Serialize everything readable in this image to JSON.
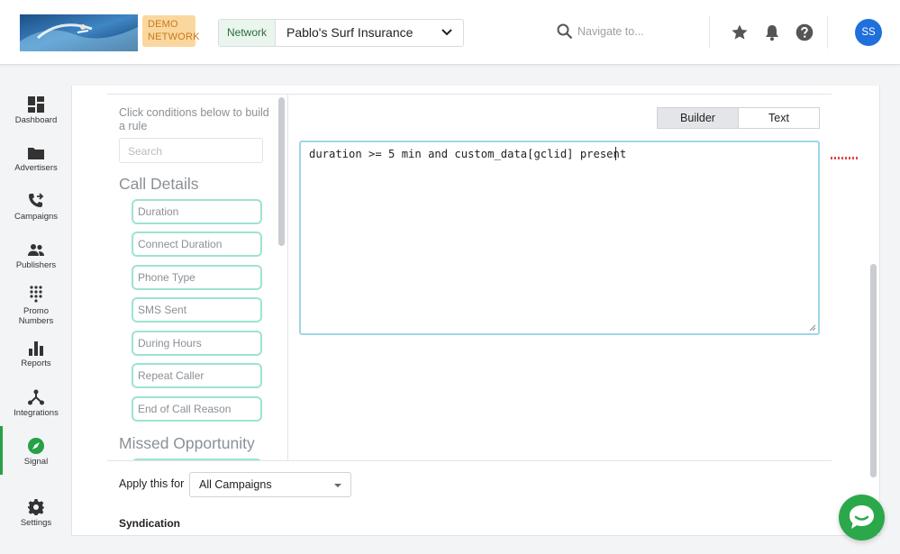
{
  "header": {
    "demo_badge": "DEMO NETWORK",
    "network_label": "Network",
    "network_value": "Pablo's Surf Insurance",
    "search_placeholder": "Navigate to...",
    "avatar_initials": "SS"
  },
  "sidebar": {
    "items": [
      {
        "label": "Dashboard",
        "icon": "dashboard-icon"
      },
      {
        "label": "Advertisers",
        "icon": "folder-icon"
      },
      {
        "label": "Campaigns",
        "icon": "phone-forward-icon"
      },
      {
        "label": "Publishers",
        "icon": "people-icon"
      },
      {
        "label": "Promo",
        "label2": "Numbers",
        "icon": "dialpad-icon"
      },
      {
        "label": "Reports",
        "icon": "bar-chart-icon"
      },
      {
        "label": "Integrations",
        "icon": "integrations-icon"
      },
      {
        "label": "Signal",
        "icon": "compass-icon",
        "active": true
      },
      {
        "label": "Settings",
        "icon": "gear-icon"
      }
    ],
    "active_color": "#27a046"
  },
  "conditions": {
    "help_text": "Click conditions below to build a rule",
    "search_placeholder": "Search",
    "section_call_details": "Call Details",
    "items": [
      "Duration",
      "Connect Duration",
      "Phone Type",
      "SMS Sent",
      "During Hours",
      "Repeat Caller",
      "End of Call Reason"
    ],
    "section_missed": "Missed Opportunity"
  },
  "editor": {
    "toggle_builder": "Builder",
    "toggle_text": "Text",
    "active_mode": "Text",
    "rule_text": "duration >= 5 min and custom_data[gclid] present"
  },
  "apply": {
    "label": "Apply this for",
    "value": "All Campaigns"
  },
  "syndication_label": "Syndication",
  "colors": {
    "accent_green": "#2ba84a",
    "avatar_blue": "#1f6fdc",
    "condition_border": "#9ee2d3",
    "editor_focus": "#9fd6ea"
  }
}
